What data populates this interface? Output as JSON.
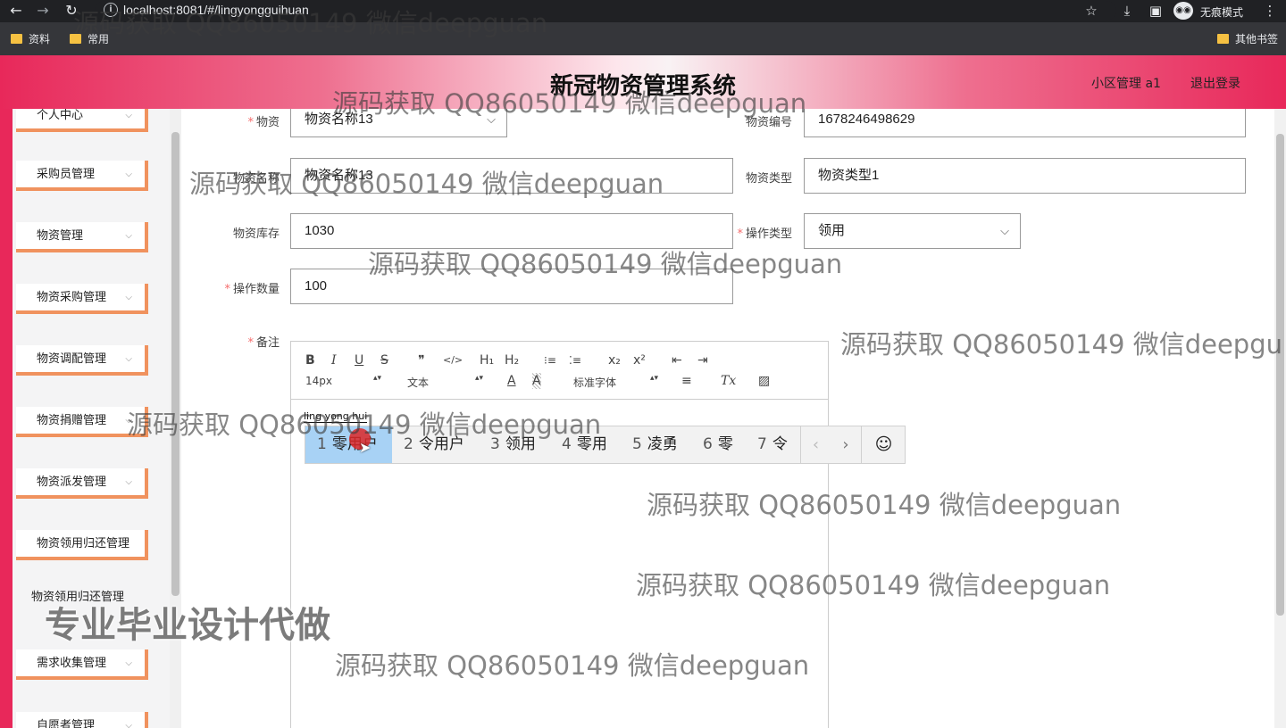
{
  "browser": {
    "back_icon": "←",
    "forward_icon": "→",
    "reload_icon": "↻",
    "url": "localhost:8081/#/lingyongguihuan",
    "star_icon": "☆",
    "download_icon": "⤓",
    "sidepanel_icon": "▣",
    "incognito_icon": "◉◉",
    "incognito_label": "无痕模式",
    "menu_icon": "⋮",
    "bookmarks": [
      "资料",
      "常用"
    ],
    "other_bookmarks": "其他书签"
  },
  "header": {
    "title": "新冠物资管理系统",
    "user": "小区管理 a1",
    "logout": "退出登录"
  },
  "sidebar": {
    "items": [
      "个人中心",
      "采购员管理",
      "物资管理",
      "物资采购管理",
      "物资调配管理",
      "物资捐赠管理",
      "物资派发管理",
      "物资领用归还管理",
      "需求收集管理",
      "自愿者管理"
    ],
    "floating_item": "物资领用归还管理",
    "chevron": "⌵"
  },
  "form": {
    "wuzi": {
      "label": "物资",
      "value": "物资名称13"
    },
    "wuzibianhao": {
      "label": "物资编号",
      "value": "1678246498629"
    },
    "wuzimingcheng": {
      "label": "物资名称",
      "value": "物资名称13"
    },
    "wuzileixing": {
      "label": "物资类型",
      "value": "物资类型1"
    },
    "wuzikucun": {
      "label": "物资库存",
      "value": "1030"
    },
    "caozuoleixing": {
      "label": "操作类型",
      "value": "领用"
    },
    "caozuoshuliang": {
      "label": "操作数量",
      "value": "100"
    },
    "beizhu": {
      "label": "备注"
    },
    "required_mark": "*",
    "select_arrow": "⌵"
  },
  "editor": {
    "toolbar": {
      "bold": "B",
      "italic": "I",
      "underline": "U",
      "strike": "S",
      "quote": "❞",
      "code": "</>",
      "h1": "H₁",
      "h2": "H₂",
      "ordered_list": "⁝≡",
      "bullet_list": "⁚≡",
      "subscript": "x₂",
      "superscript": "x²",
      "outdent": "⇤",
      "indent": "⇥",
      "size": "14px",
      "type": "文本",
      "font_color": "A",
      "highlight": "A",
      "font": "标准字体",
      "align": "≡",
      "clear": "Tx",
      "image": "▨",
      "select_arrows": "▴▾"
    },
    "composing_pinyin": "ling yong hui"
  },
  "ime": {
    "candidates": [
      {
        "num": "1",
        "text": "零用户"
      },
      {
        "num": "2",
        "text": "令用户"
      },
      {
        "num": "3",
        "text": "领用"
      },
      {
        "num": "4",
        "text": "零用"
      },
      {
        "num": "5",
        "text": "凌勇"
      },
      {
        "num": "6",
        "text": "零"
      },
      {
        "num": "7",
        "text": "令"
      }
    ],
    "prev_icon": "‹",
    "next_icon": "›",
    "emoji_icon": "☺"
  },
  "watermark": {
    "text": "源码获取 QQ86050149 微信deepguan",
    "text_cut": "源码获取 QQ86050149 微信deepgu",
    "big": "专业毕业设计代做"
  },
  "colors": {
    "accent": "#e8285a",
    "menu_border": "#f0925e",
    "required": "#f56c6c",
    "ime_highlight": "#a8d2f5"
  }
}
